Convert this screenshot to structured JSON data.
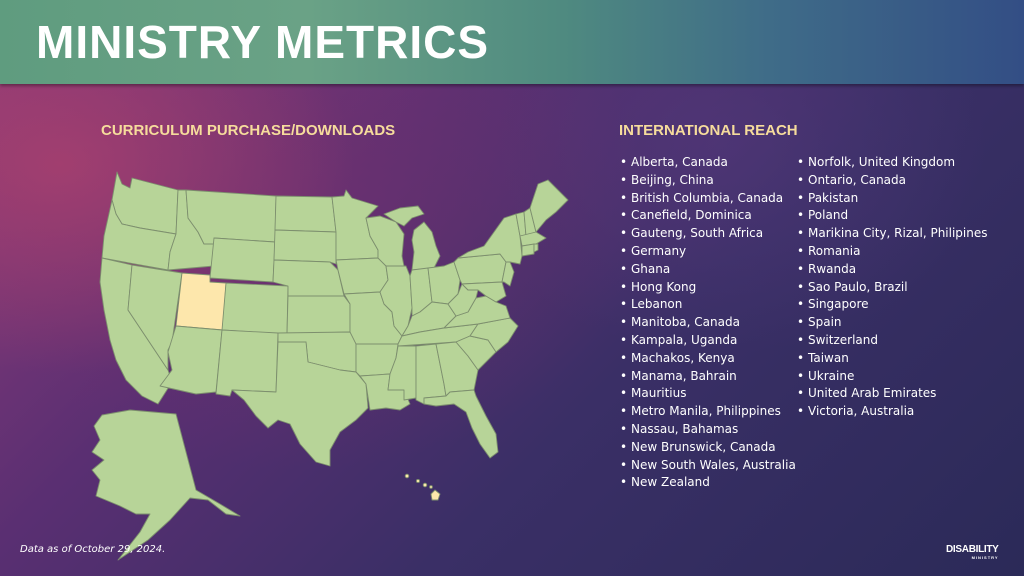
{
  "header": {
    "title": "MINISTRY METRICS"
  },
  "map_section": {
    "title": "CURRICULUM PURCHASE/DOWNLOADS",
    "colors": {
      "default_state": "#b7d498",
      "highlighted_state": "#fde7ac",
      "border": "#7d8f6e"
    },
    "highlighted_states": [
      "Utah",
      "Hawaii"
    ]
  },
  "reach_section": {
    "title": "INTERNATIONAL REACH",
    "column1": [
      "Alberta, Canada",
      "Beijing, China",
      "British Columbia, Canada",
      "Canefield, Dominica",
      "Gauteng, South Africa",
      "Germany",
      "Ghana",
      "Hong Kong",
      "Lebanon",
      "Manitoba, Canada",
      "Kampala, Uganda",
      "Machakos, Kenya",
      "Manama, Bahrain",
      "Mauritius",
      "Metro Manila, Philippines",
      "Nassau, Bahamas",
      "New Brunswick, Canada",
      "New South Wales, Australia",
      "New Zealand"
    ],
    "column2": [
      "Norfolk, United Kingdom",
      "Ontario, Canada",
      "Pakistan",
      "Poland",
      "Marikina City, Rizal, Philipines",
      "Romania",
      "Rwanda",
      "Sao Paulo, Brazil",
      "Singapore",
      "Spain",
      "Switzerland",
      "Taiwan",
      "Ukraine",
      "United Arab Emirates",
      "Victoria, Australia"
    ]
  },
  "footer": {
    "note": "Data as of  October 29, 2024.",
    "logo_main": "DISABILITY",
    "logo_sub": "MINISTRY"
  }
}
